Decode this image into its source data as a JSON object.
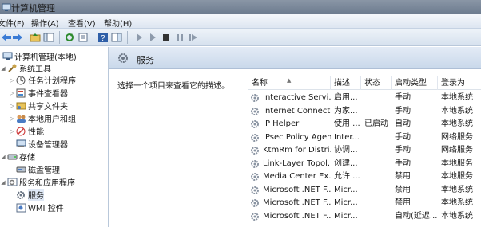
{
  "window": {
    "title": "计算机管理"
  },
  "menu": [
    "文件(F)",
    "操作(A)",
    "查看(V)",
    "帮助(H)"
  ],
  "tree": {
    "root": "计算机管理(本地)",
    "system_tools": "系统工具",
    "task_scheduler": "任务计划程序",
    "event_viewer": "事件查看器",
    "shared_folders": "共享文件夹",
    "local_users": "本地用户和组",
    "performance": "性能",
    "device_manager": "设备管理器",
    "storage": "存储",
    "disk_mgmt": "磁盘管理",
    "services_apps": "服务和应用程序",
    "services": "服务",
    "wmi": "WMI 控件"
  },
  "right": {
    "header": "服务",
    "description": "选择一个项目来查看它的描述。"
  },
  "columns": {
    "name": "名称",
    "desc": "描述",
    "status": "状态",
    "startup": "启动类型",
    "logon": "登录为"
  },
  "services": [
    {
      "name": "Interactive Servi...",
      "desc": "启用...",
      "status": "",
      "startup": "手动",
      "logon": "本地系统"
    },
    {
      "name": "Internet Connect...",
      "desc": "为家...",
      "status": "",
      "startup": "手动",
      "logon": "本地系统"
    },
    {
      "name": "IP Helper",
      "desc": "使用 ...",
      "status": "已启动",
      "startup": "自动",
      "logon": "本地系统"
    },
    {
      "name": "IPsec Policy Agent",
      "desc": "Inter...",
      "status": "",
      "startup": "手动",
      "logon": "网络服务"
    },
    {
      "name": "KtmRm for Distri...",
      "desc": "协调...",
      "status": "",
      "startup": "手动",
      "logon": "网络服务"
    },
    {
      "name": "Link-Layer Topol...",
      "desc": "创建...",
      "status": "",
      "startup": "手动",
      "logon": "本地服务"
    },
    {
      "name": "Media Center Ex...",
      "desc": "允许 ...",
      "status": "",
      "startup": "禁用",
      "logon": "本地服务"
    },
    {
      "name": "Microsoft .NET F...",
      "desc": "Micr...",
      "status": "",
      "startup": "禁用",
      "logon": "本地系统"
    },
    {
      "name": "Microsoft .NET F...",
      "desc": "Micr...",
      "status": "",
      "startup": "禁用",
      "logon": "本地系统"
    },
    {
      "name": "Microsoft .NET F...",
      "desc": "Micr...",
      "status": "",
      "startup": "自动(延迟...",
      "logon": "本地系统"
    }
  ]
}
